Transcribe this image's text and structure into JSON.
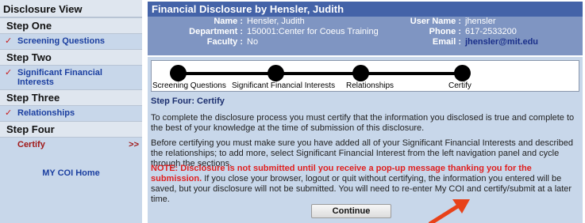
{
  "sidebar": {
    "title": "Disclosure View",
    "steps": [
      {
        "heading": "Step One",
        "item": "Screening Questions",
        "checked": true
      },
      {
        "heading": "Step Two",
        "item": "Significant Financial Interests",
        "checked": true
      },
      {
        "heading": "Step Three",
        "item": "Relationships",
        "checked": true
      },
      {
        "heading": "Step Four",
        "item": "Certify",
        "checked": false,
        "current_marker": ">>"
      }
    ],
    "check_glyph": "✓",
    "home_link": "MY COI Home"
  },
  "header": {
    "title": "Financial Disclosure by Hensler, Judith",
    "name_label": "Name :",
    "name_value": "Hensler, Judith",
    "department_label": "Department :",
    "department_value": "150001:Center for Coeus Training",
    "faculty_label": "Faculty :",
    "faculty_value": "No",
    "username_label": "User Name :",
    "username_value": "jhensler",
    "phone_label": "Phone :",
    "phone_value": "617-2533200",
    "email_label": "Email :",
    "email_value": "jhensler@mit.edu"
  },
  "progress": {
    "labels": [
      "Screening Questions",
      "Significant Financial Interests",
      "Relationships",
      "Certify"
    ]
  },
  "content": {
    "heading": "Step Four: Certify",
    "para1": "To complete the disclosure process you must certify that the information you disclosed is true and complete to the best of your knowledge at the time of submission of this disclosure.",
    "para2": "Before certifying you must make sure you have added all of your Significant Financial Interests and described the relationships; to add more, select Significant Financial Interest from the left navigation panel and cycle through the sections.",
    "warning": "NOTE: Disclosure is not submitted until you receive a pop-up message thanking you for the submission.",
    "para3_rest": " If you close your browser, logout or quit without certifying, the information you entered will be saved, but your disclosure will not be submitted. You will need to re-enter My COI and certify/submit at a later time.",
    "continue_label": "Continue"
  },
  "colors": {
    "sidebar_bg": "#c8d7ea",
    "header_title_bg": "#4463a8",
    "header_bg": "#7f95c2",
    "link": "#1b3fa0",
    "warning": "#e02020",
    "check": "#c81a1a",
    "annotation_arrow": "#e8421a"
  }
}
